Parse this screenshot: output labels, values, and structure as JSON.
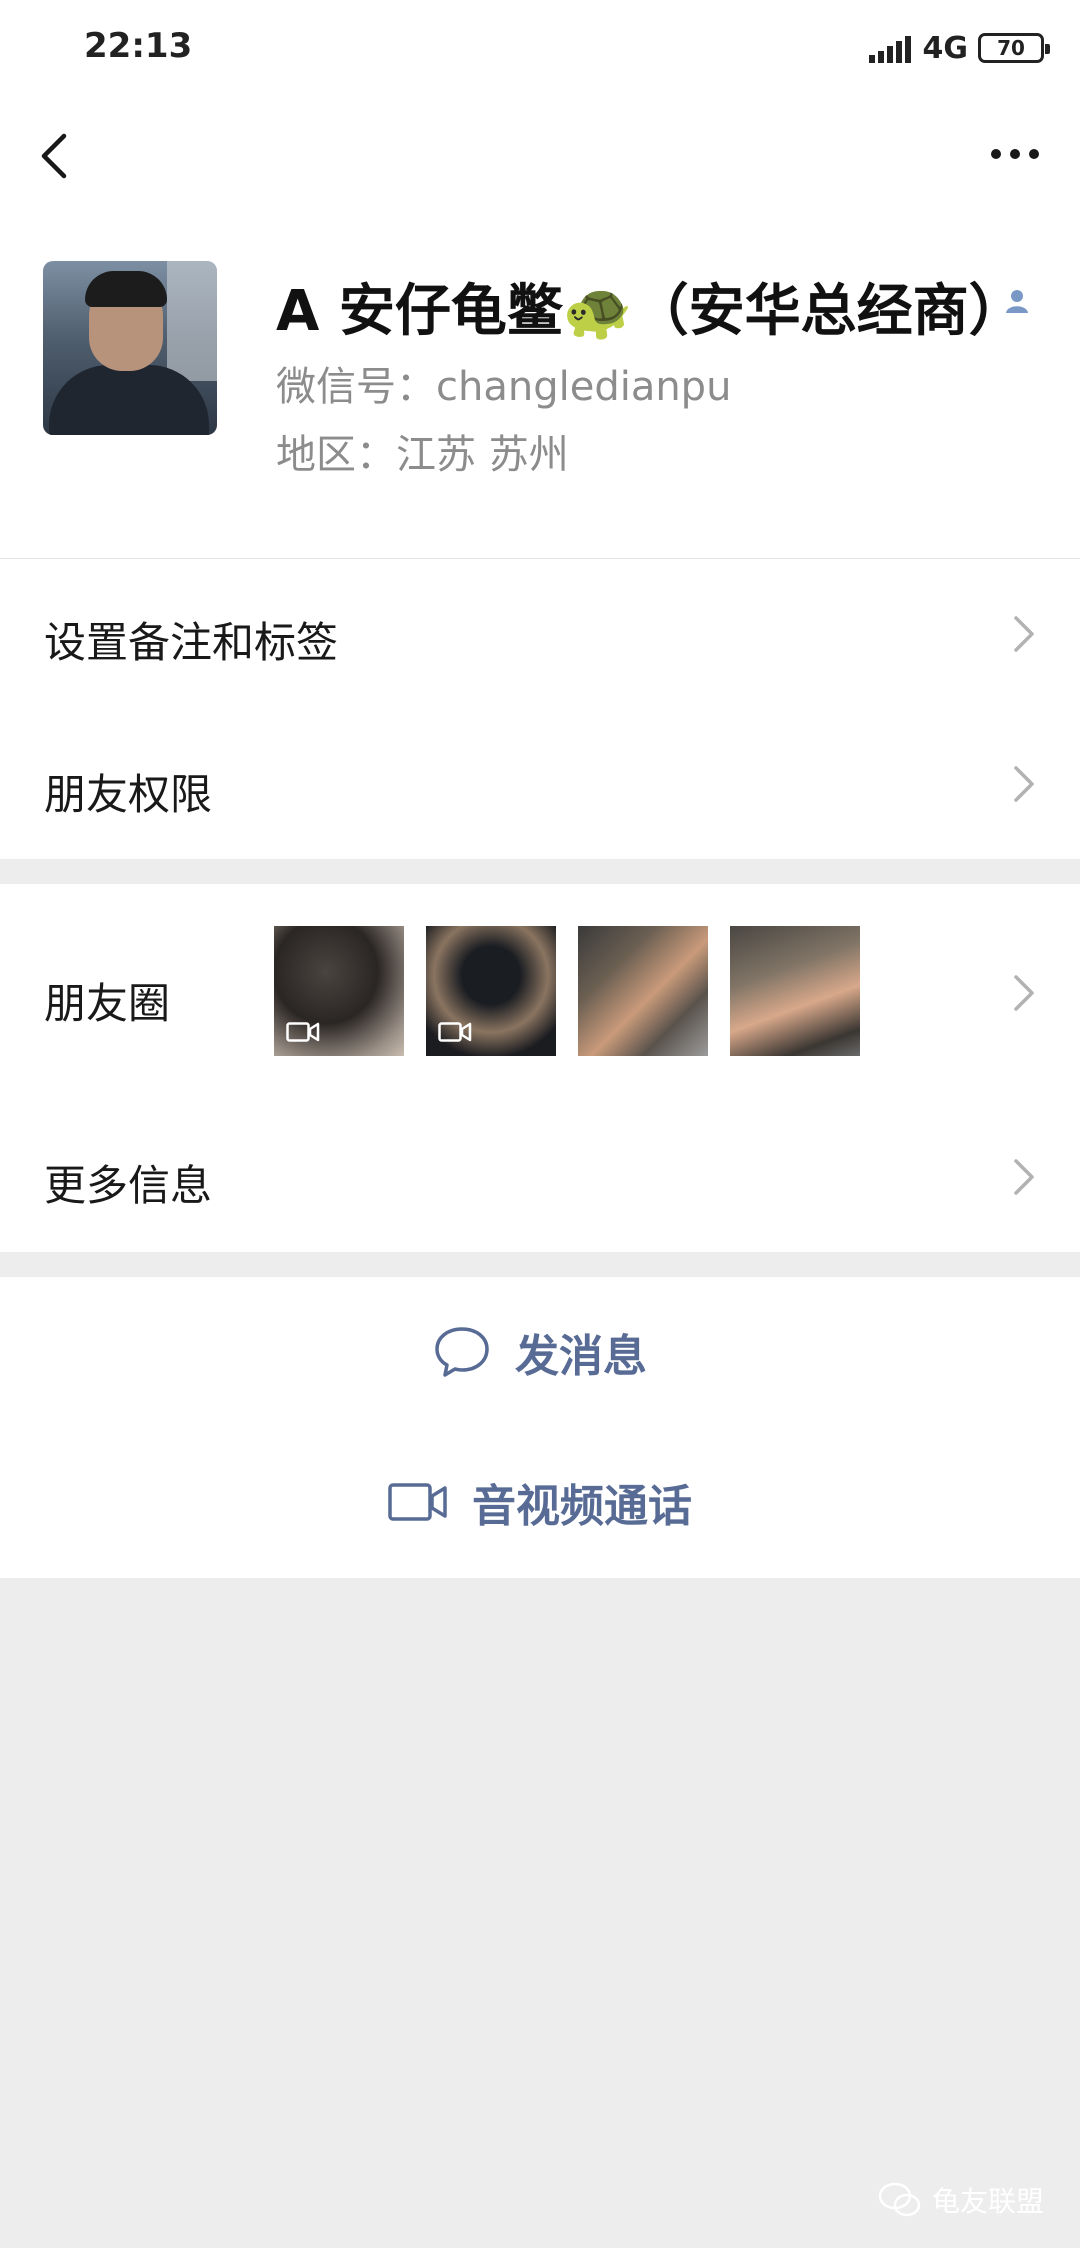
{
  "status_bar": {
    "time": "22:13",
    "network": "4G",
    "battery": "70"
  },
  "profile": {
    "name": "A 安仔龟鳖🐢（安华总经商）",
    "wechat_id": "微信号：changledianpu",
    "region": "地区：江苏  苏州"
  },
  "menu": {
    "remark": "设置备注和标签",
    "permissions": "朋友权限",
    "moments": "朋友圈",
    "more_info": "更多信息"
  },
  "actions": {
    "message": "发消息",
    "call": "音视频通话"
  },
  "watermark": "龟友联盟",
  "colors": {
    "link_blue": "#576b95",
    "background": "#ededed"
  }
}
